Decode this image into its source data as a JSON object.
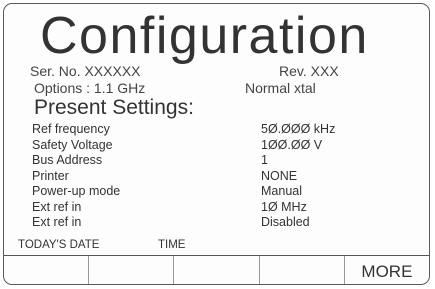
{
  "header": {
    "title": "Configuration",
    "serial_label": "Ser. No. XXXXXX",
    "revision_label": "Rev. XXX",
    "options_label": "Options :  1.1  GHz",
    "options_mode": "Normal   xtal"
  },
  "settings": {
    "heading": "Present Settings:",
    "rows": [
      {
        "label": "Ref frequency",
        "value": "5Ø.ØØØ kHz"
      },
      {
        "label": "Safety Voltage",
        "value": "1ØØ.ØØ V"
      },
      {
        "label": "Bus Address",
        "value": "1"
      },
      {
        "label": "Printer",
        "value": "NONE"
      },
      {
        "label": "Power-up mode",
        "value": "Manual"
      },
      {
        "label": "Ext ref in",
        "value": "1Ø MHz"
      },
      {
        "label": "Ext ref in",
        "value": "Disabled"
      }
    ]
  },
  "status": {
    "date_label": "TODAY'S DATE",
    "time_label": "TIME"
  },
  "softkeys": [
    "",
    "",
    "",
    "",
    "MORE"
  ]
}
